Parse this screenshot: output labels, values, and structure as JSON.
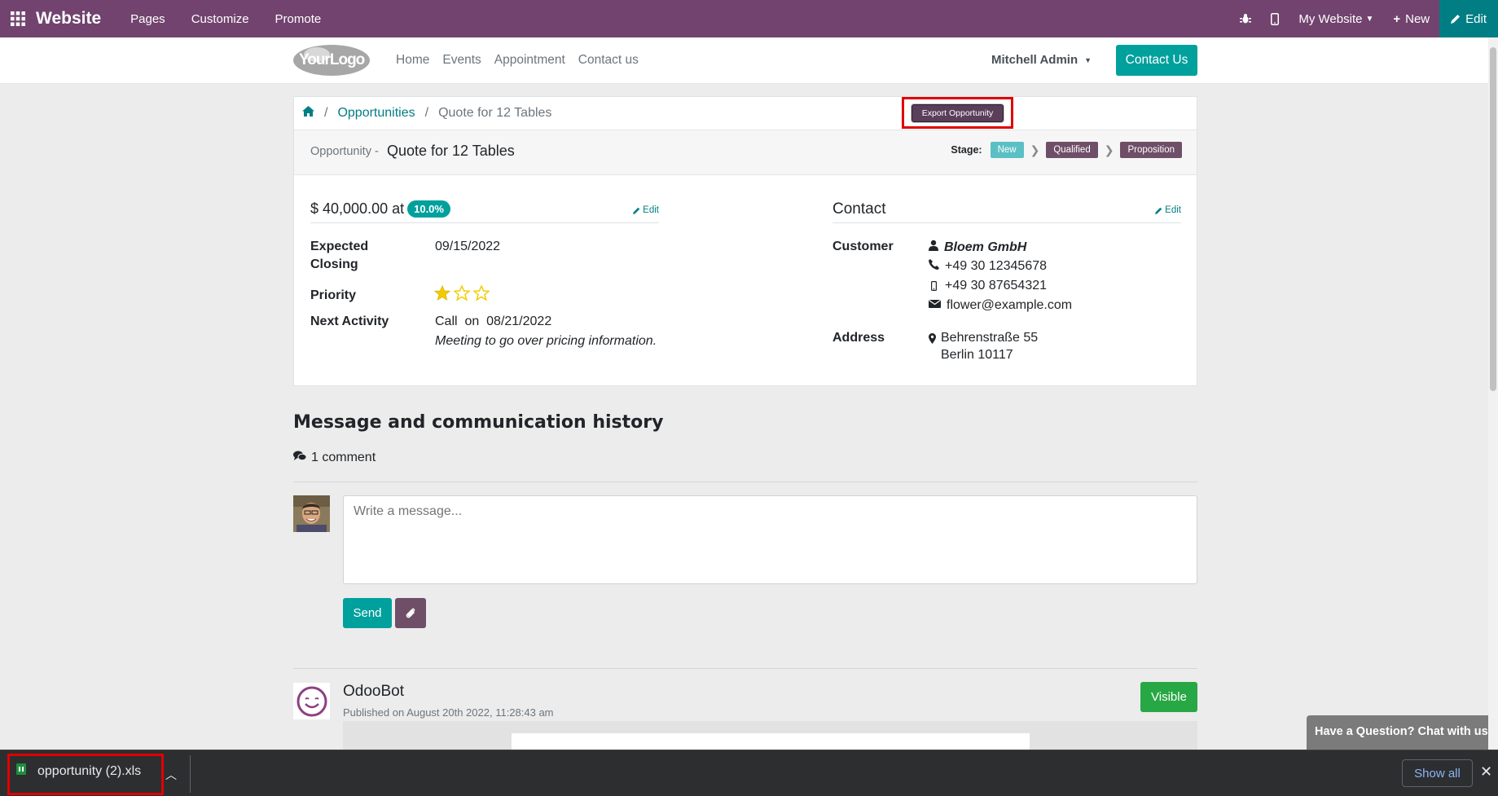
{
  "topbar": {
    "brand": "Website",
    "menu": [
      "Pages",
      "Customize",
      "Promote"
    ],
    "site_selector": "My Website",
    "new_label": "New",
    "edit_label": "Edit"
  },
  "header": {
    "logo_text": "YourLogo",
    "nav": [
      "Home",
      "Events",
      "Appointment",
      "Contact us"
    ],
    "user": "Mitchell Admin",
    "contact_button": "Contact Us"
  },
  "breadcrumb": {
    "items": [
      "Opportunities",
      "Quote for 12 Tables"
    ],
    "separator": "/"
  },
  "export_button": "Export Opportunity",
  "opportunity": {
    "label": "Opportunity -",
    "name": "Quote for 12 Tables",
    "stage_label": "Stage:",
    "stages": [
      "New",
      "Qualified",
      "Proposition"
    ],
    "amount": "$ 40,000.00 at",
    "probability": "10.0%",
    "edit_label": "Edit",
    "expected_closing_label_1": "Expected",
    "expected_closing_label_2": "Closing",
    "expected_closing": "09/15/2022",
    "priority_label": "Priority",
    "priority_stars": 1,
    "priority_max": 3,
    "next_activity_label": "Next Activity",
    "next_activity": "Call  on  08/21/2022",
    "next_activity_note": "Meeting to go over pricing information."
  },
  "contact": {
    "title": "Contact",
    "edit_label": "Edit",
    "customer_label": "Customer",
    "customer": "Bloem GmbH",
    "phone": "+49 30 12345678",
    "mobile": "+49 30 87654321",
    "email": "flower@example.com",
    "address_label": "Address",
    "address_line1": "Behrenstraße 55",
    "address_line2": "Berlin 10117"
  },
  "messages": {
    "title": "Message and communication history",
    "comment_count": "1 comment",
    "input_placeholder": "Write a message...",
    "send_label": "Send",
    "author": "OdooBot",
    "published": "Published on August 20th 2022, 11:28:43 am",
    "visible_label": "Visible"
  },
  "chat": {
    "label": "Have a Question? Chat with us."
  },
  "download_bar": {
    "file_name": "opportunity (2).xls",
    "show_all": "Show all"
  },
  "colors": {
    "topbar": "#71436e",
    "accent": "#00a09d",
    "highlight": "#e00000"
  }
}
